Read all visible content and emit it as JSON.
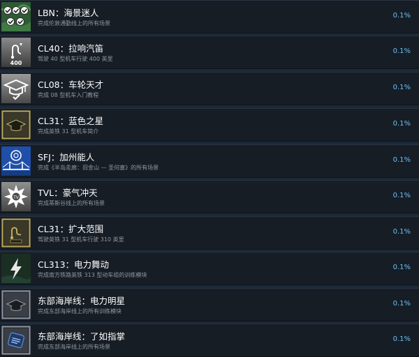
{
  "achievements": [
    {
      "title": "LBN：海景迷人",
      "description": "完成伦敦通勤线上的所有场景",
      "percent": "0.1%",
      "icon": "map-checkmarks-icon"
    },
    {
      "title": "CL40：拉响汽笛",
      "description": "驾驶 40 型机车行驶 400 英里",
      "percent": "0.1%",
      "icon": "route-400-icon"
    },
    {
      "title": "CL08：车轮天才",
      "description": "完成 08 型机车入门教程",
      "percent": "0.1%",
      "icon": "graduation-cap-icon"
    },
    {
      "title": "CL31：蓝色之星",
      "description": "完成英铁 31 型机车简介",
      "percent": "0.1%",
      "icon": "gold-cap-icon"
    },
    {
      "title": "SFJ：加州能人",
      "description": "完成《半岛走廊：旧金山 — 圣何塞》的所有场景",
      "percent": "0.1%",
      "icon": "bridge-icon"
    },
    {
      "title": "TVL：豪气冲天",
      "description": "完成蒂斯谷线上的所有场景",
      "percent": "0.1%",
      "icon": "burst-emblem-icon"
    },
    {
      "title": "CL31：扩大范围",
      "description": "驾驶英铁 31 型机车行驶 310 英里",
      "percent": "0.1%",
      "icon": "gold-route-icon"
    },
    {
      "title": "CL313：电力舞动",
      "description": "完成南方铁路英铁 313 型动车组的训练模块",
      "percent": "0.1%",
      "icon": "lightning-icon"
    },
    {
      "title": "东部海岸线：电力明星",
      "description": "完成东部海岸线上的所有训练模块",
      "percent": "0.1%",
      "icon": "silver-cap-icon"
    },
    {
      "title": "东部海岸线：了如指掌",
      "description": "完成东部海岸线上的所有场景",
      "percent": "0.1%",
      "icon": "blue-badge-icon"
    }
  ]
}
